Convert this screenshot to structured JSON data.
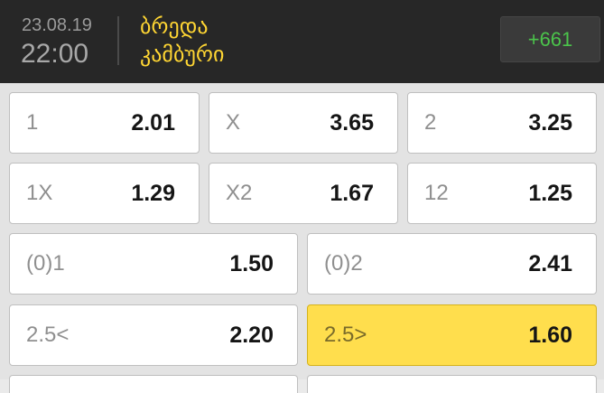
{
  "header": {
    "date": "23.08.19",
    "time": "22:00",
    "team1": "ბრედა",
    "team2": "კამბური",
    "more_markets": "+661"
  },
  "odds": [
    {
      "label": "1",
      "value": "2.01"
    },
    {
      "label": "X",
      "value": "3.65"
    },
    {
      "label": "2",
      "value": "3.25"
    },
    {
      "label": "1X",
      "value": "1.29"
    },
    {
      "label": "X2",
      "value": "1.67"
    },
    {
      "label": "12",
      "value": "1.25"
    },
    {
      "label": "(0)1",
      "value": "1.50"
    },
    {
      "label": "(0)2",
      "value": "2.41"
    },
    {
      "label": "2.5<",
      "value": "2.20"
    },
    {
      "label": "2.5>",
      "value": "1.60",
      "selected": true
    }
  ],
  "colors": {
    "header_bg": "#272727",
    "team_name": "#ffd633",
    "more_markets": "#4bc44b",
    "selected_bg": "#ffde4d"
  }
}
